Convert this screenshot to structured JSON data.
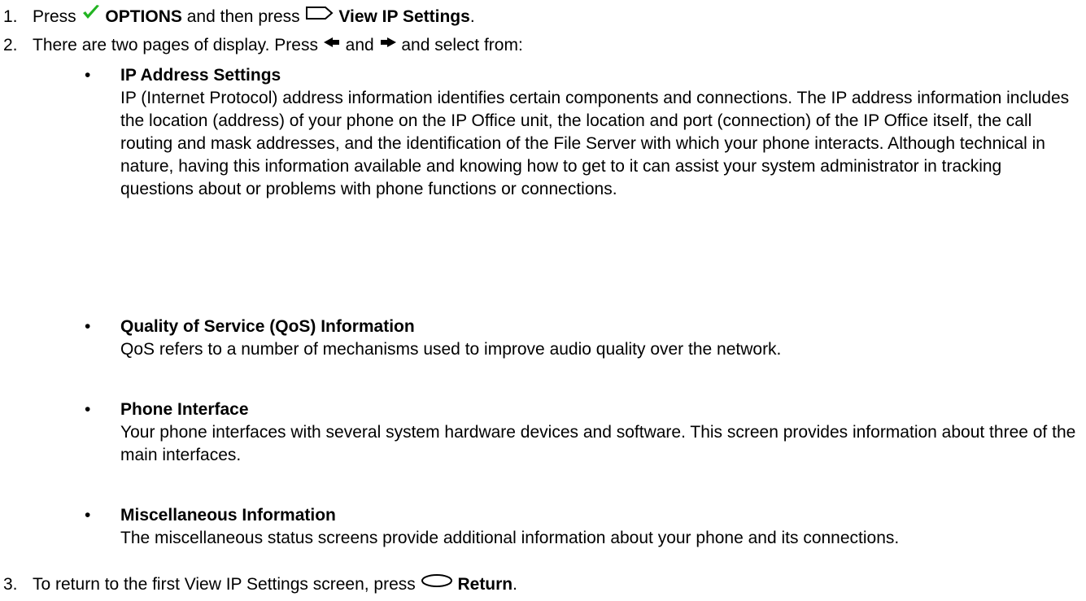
{
  "steps": {
    "s1": {
      "num": "1.",
      "t1": "Press",
      "b1": "OPTIONS",
      "t2": "and then press",
      "b2": "View IP Settings",
      "t3": "."
    },
    "s2": {
      "num": "2.",
      "t1": "There are two pages of display. Press",
      "t2": "and",
      "t3": "and select from:"
    },
    "s3": {
      "num": "3.",
      "t1": "To return to the first View IP Settings screen, press",
      "b1": "Return",
      "t2": "."
    }
  },
  "bullets": [
    {
      "title": "IP Address Settings",
      "desc": "IP (Internet Protocol) address information identifies certain components and connections. The IP address information includes the location (address) of your phone on the IP Office unit, the location and port (connection) of the IP Office itself, the call routing and mask addresses, and the identification of the File Server with which your phone interacts. Although technical in nature, having this information available and knowing how to get to it can assist your system administrator in tracking questions about or problems with phone functions or connections."
    },
    {
      "title": "Quality of Service (QoS) Information",
      "desc": "QoS refers to a number of mechanisms used to improve audio quality over the network."
    },
    {
      "title": "Phone Interface",
      "desc": "Your phone interfaces with several system hardware devices and software. This screen provides information about three of the main interfaces."
    },
    {
      "title": "Miscellaneous Information",
      "desc": "The miscellaneous status screens provide additional information about your phone and its connections."
    }
  ],
  "bullet_glyph": "•",
  "icons": {
    "options": "checkmark-icon",
    "view_ip": "softkey-icon",
    "left": "left-arrow-icon",
    "right": "right-arrow-icon",
    "return": "return-key-icon",
    "check_color": "#22b422"
  }
}
